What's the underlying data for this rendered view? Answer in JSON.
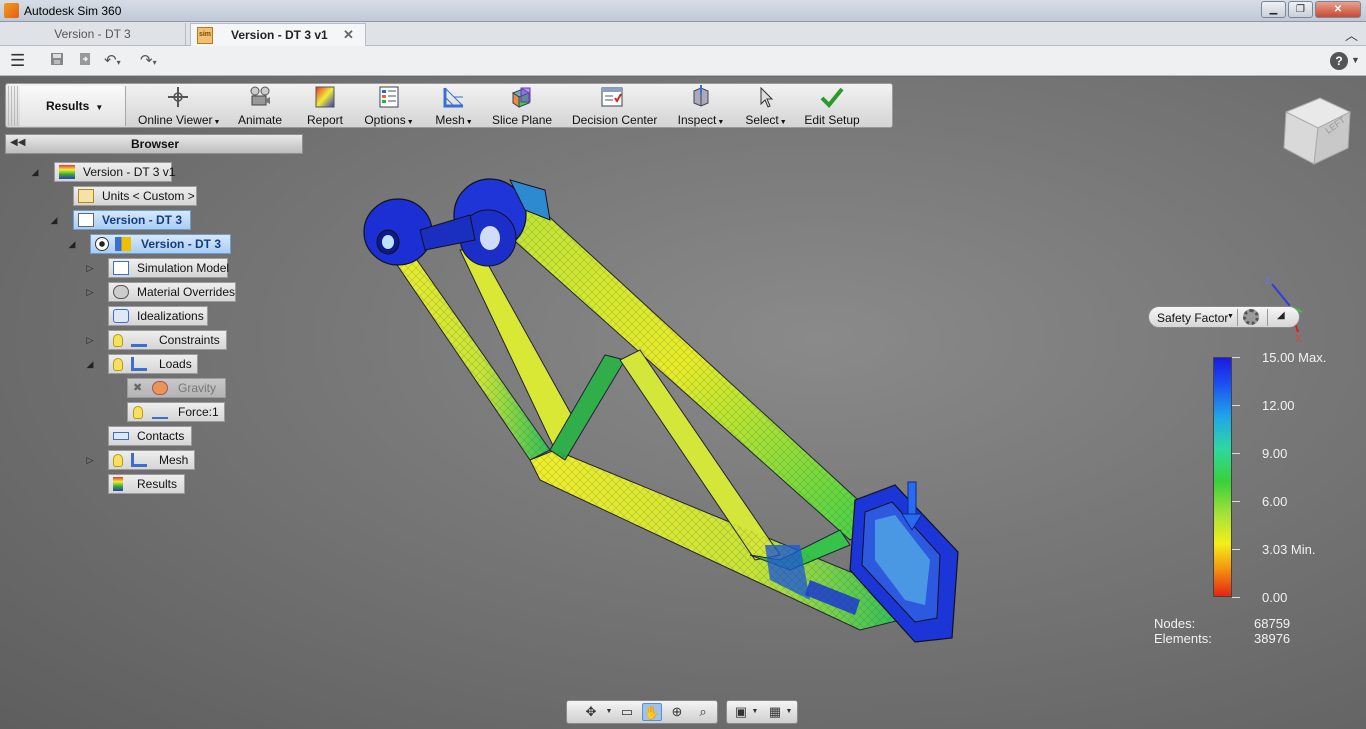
{
  "window": {
    "title": "Autodesk Sim 360"
  },
  "tabs": [
    {
      "label": "Version - DT 3"
    },
    {
      "label": "Version - DT 3 v1",
      "icon_text": "sim"
    }
  ],
  "ribbon": {
    "mode_label": "Results",
    "buttons": [
      {
        "label": "Online Viewer",
        "icon": "online-viewer-icon",
        "dropdown": true
      },
      {
        "label": "Animate",
        "icon": "animate-icon"
      },
      {
        "label": "Report",
        "icon": "report-icon"
      },
      {
        "label": "Options",
        "icon": "options-icon",
        "dropdown": true
      },
      {
        "label": "Mesh",
        "icon": "mesh-icon",
        "dropdown": true
      },
      {
        "label": "Slice Plane",
        "icon": "slice-plane-icon"
      },
      {
        "label": "Decision Center",
        "icon": "decision-center-icon"
      },
      {
        "label": "Inspect",
        "icon": "inspect-icon",
        "dropdown": true
      },
      {
        "label": "Select",
        "icon": "select-icon",
        "dropdown": true
      },
      {
        "label": "Edit Setup",
        "icon": "checkmark-icon"
      }
    ]
  },
  "browser": {
    "title": "Browser",
    "nodes": [
      {
        "label": "Version - DT 3 v1"
      },
      {
        "label": "Units < Custom >"
      },
      {
        "label": "Version - DT 3",
        "selected": true
      },
      {
        "label": "Version - DT 3",
        "selected": true
      },
      {
        "label": "Simulation Model"
      },
      {
        "label": "Material Overrides"
      },
      {
        "label": "Idealizations"
      },
      {
        "label": "Constraints"
      },
      {
        "label": "Loads"
      },
      {
        "label": "Gravity",
        "disabled": true
      },
      {
        "label": "Force:1"
      },
      {
        "label": "Contacts"
      },
      {
        "label": "Mesh"
      },
      {
        "label": "Results"
      }
    ]
  },
  "viewcube": {
    "face_label": "LEFT"
  },
  "triad": {
    "z": "Z",
    "x": "X"
  },
  "legend": {
    "result_type": "Safety Factor",
    "values": [
      "15.00 Max.",
      "12.00",
      "9.00",
      "6.00",
      "3.03 Min.",
      "0.00"
    ],
    "max": 15.0,
    "min": 3.03,
    "colors": {
      "high": "#1b1bdf",
      "low": "#e52414"
    }
  },
  "stats": {
    "nodes_label": "Nodes:",
    "nodes_value": "68759",
    "elements_label": "Elements:",
    "elements_value": "38976"
  }
}
